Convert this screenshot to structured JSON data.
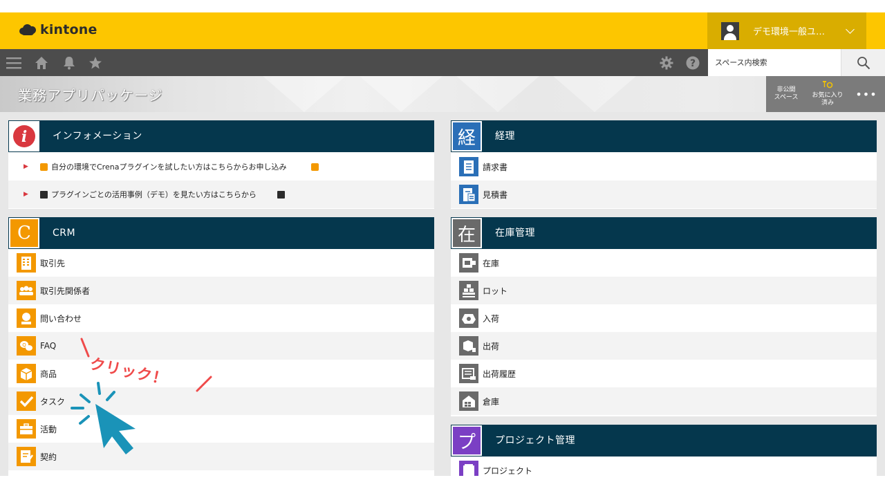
{
  "header": {
    "logo_text": "kintone",
    "user_name": "デモ環境一般ユ…",
    "brand_color": "#fdc600"
  },
  "nav": {
    "icons": [
      "menu-icon",
      "home-icon",
      "bell-icon",
      "star-icon"
    ],
    "right_icons": [
      "gear-icon",
      "help-icon"
    ],
    "search_placeholder": "スペース内検索"
  },
  "space": {
    "title": "業務アプリパッケージ",
    "private_label_line1": "非公開",
    "private_label_line2": "スペース",
    "favorite_label_line1": "お気に入り",
    "favorite_label_line2": "済み",
    "more_label": "•••"
  },
  "panels": {
    "info": {
      "badge": "i",
      "title": "インフォメーション",
      "items": [
        "自分の環境でCrenaプラグインを試したい方はこちらからお申し込み",
        "プラグインごとの活用事例（デモ）を見たい方はこちらから"
      ]
    },
    "crm": {
      "badge": "C",
      "title": "CRM",
      "color": "#f39800",
      "apps": [
        "取引先",
        "取引先関係者",
        "問い合わせ",
        "FAQ",
        "商品",
        "タスク",
        "活動",
        "契約"
      ]
    },
    "accounting": {
      "badge": "経",
      "title": "経理",
      "color": "#2a6fb7",
      "apps": [
        "請求書",
        "見積書"
      ]
    },
    "inventory": {
      "badge": "在",
      "title": "在庫管理",
      "color": "#6a6a6a",
      "apps": [
        "在庫",
        "ロット",
        "入荷",
        "出荷",
        "出荷履歴",
        "倉庫"
      ]
    },
    "project": {
      "badge": "プ",
      "title": "プロジェクト管理",
      "color": "#7b3fc4",
      "apps": [
        "プロジェクト"
      ]
    }
  },
  "annotation": {
    "text": "クリック！",
    "text_color": "#ef4a4a",
    "cursor_color": "#1a93b8"
  }
}
